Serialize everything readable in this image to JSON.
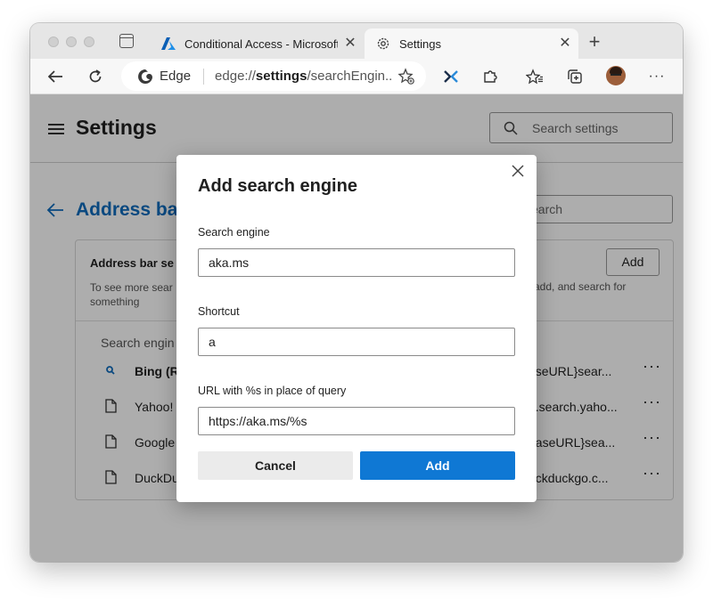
{
  "browser": {
    "tabs": [
      {
        "title": "Conditional Access - Microsoft",
        "favicon": "azure-icon",
        "active": false
      },
      {
        "title": "Settings",
        "favicon": "gear-icon",
        "active": true
      }
    ],
    "omnibox": {
      "label": "Edge",
      "url_prefix": "edge://",
      "url_bold": "settings",
      "url_rest": "/searchEngin..."
    }
  },
  "settings": {
    "title": "Settings",
    "search_placeholder": "Search settings",
    "section_title": "Address bar",
    "section_search_placeholder": "earch",
    "card": {
      "title": "Address bar se",
      "desc_line1": "To see more sear",
      "desc_line2": "something",
      "desc_right": "add, and search for",
      "add_label": "Add",
      "column_header": "Search engin",
      "engines": [
        {
          "name": "Bing (R",
          "url": "aseURL}sear...",
          "icon": "search-icon",
          "bold": true
        },
        {
          "name": "Yahoo!",
          "url": "u.search.yaho...",
          "icon": "document-icon",
          "bold": false
        },
        {
          "name": "Google",
          "url": "baseURL}sea...",
          "icon": "document-icon",
          "bold": false
        },
        {
          "name": "DuckDu",
          "url": "uckduckgo.c...",
          "icon": "document-icon",
          "bold": false
        }
      ],
      "more_label": "···"
    }
  },
  "dialog": {
    "title": "Add search engine",
    "fields": {
      "engine_label": "Search engine",
      "engine_value": "aka.ms",
      "shortcut_label": "Shortcut",
      "shortcut_value": "a",
      "url_label": "URL with %s in place of query",
      "url_value": "https://aka.ms/%s"
    },
    "cancel_label": "Cancel",
    "add_label": "Add"
  },
  "colors": {
    "accent": "#0f78d4",
    "link": "#0f6cbd"
  }
}
